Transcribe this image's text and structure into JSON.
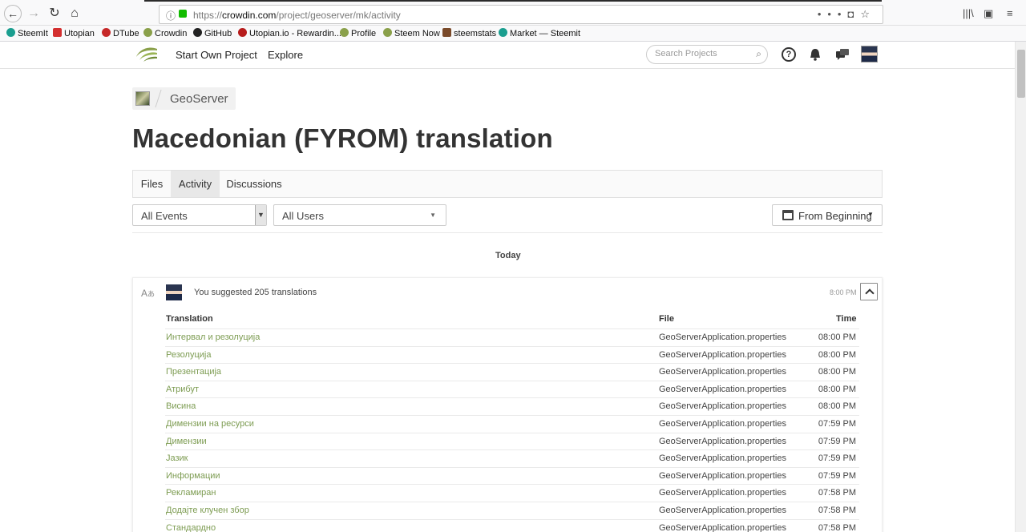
{
  "browser": {
    "url_prefix": "https://",
    "url_host": "crowdin.com",
    "url_path": "/project/geoserver/mk/activity"
  },
  "bookmarks": [
    {
      "label": "SteemIt",
      "color": "#1a9e8f"
    },
    {
      "label": "Utopian",
      "color": "#d32f2f"
    },
    {
      "label": "DTube",
      "color": "#c62828"
    },
    {
      "label": "Crowdin",
      "color": "#8aa04a"
    },
    {
      "label": "GitHub",
      "color": "#222222"
    },
    {
      "label": "Utopian.io - Rewardin...",
      "color": "#b71c1c"
    },
    {
      "label": "Profile",
      "color": "#8aa04a"
    },
    {
      "label": "Steem Now",
      "color": "#8aa04a"
    },
    {
      "label": "steemstats",
      "color": "#7a4a2a"
    },
    {
      "label": "Market — Steemit",
      "color": "#1a9e8f"
    }
  ],
  "header": {
    "nav": [
      "Start Own Project",
      "Explore"
    ],
    "search_placeholder": "Search Projects"
  },
  "project": {
    "name": "GeoServer",
    "page_title": "Macedonian (FYROM) translation"
  },
  "tabs": [
    {
      "label": "Files",
      "active": false
    },
    {
      "label": "Activity",
      "active": true
    },
    {
      "label": "Discussions",
      "active": false
    }
  ],
  "filters": {
    "events": "All Events",
    "users": "All Users",
    "range": "From Beginning"
  },
  "day_label": "Today",
  "activity": {
    "summary": "You suggested 205 translations",
    "time": "8:00 PM",
    "columns": {
      "translation": "Translation",
      "file": "File",
      "time": "Time"
    },
    "rows": [
      {
        "translation": "Интервал и резолуција",
        "file": "GeoServerApplication.properties",
        "time": "08:00 PM"
      },
      {
        "translation": "Резолуција",
        "file": "GeoServerApplication.properties",
        "time": "08:00 PM"
      },
      {
        "translation": "Презентација",
        "file": "GeoServerApplication.properties",
        "time": "08:00 PM"
      },
      {
        "translation": "Атрибут",
        "file": "GeoServerApplication.properties",
        "time": "08:00 PM"
      },
      {
        "translation": "Висина",
        "file": "GeoServerApplication.properties",
        "time": "08:00 PM"
      },
      {
        "translation": "Димензии на ресурси",
        "file": "GeoServerApplication.properties",
        "time": "07:59 PM"
      },
      {
        "translation": "Димензии",
        "file": "GeoServerApplication.properties",
        "time": "07:59 PM"
      },
      {
        "translation": "Јазик",
        "file": "GeoServerApplication.properties",
        "time": "07:59 PM"
      },
      {
        "translation": "Информации",
        "file": "GeoServerApplication.properties",
        "time": "07:59 PM"
      },
      {
        "translation": "Рекламиран",
        "file": "GeoServerApplication.properties",
        "time": "07:58 PM"
      },
      {
        "translation": "Додајте клучен збор",
        "file": "GeoServerApplication.properties",
        "time": "07:58 PM"
      },
      {
        "translation": "Стандардно",
        "file": "GeoServerApplication.properties",
        "time": "07:58 PM"
      }
    ]
  },
  "colors": {
    "accent_green": "#7d9c52",
    "brand_green": "#8aa04a"
  }
}
